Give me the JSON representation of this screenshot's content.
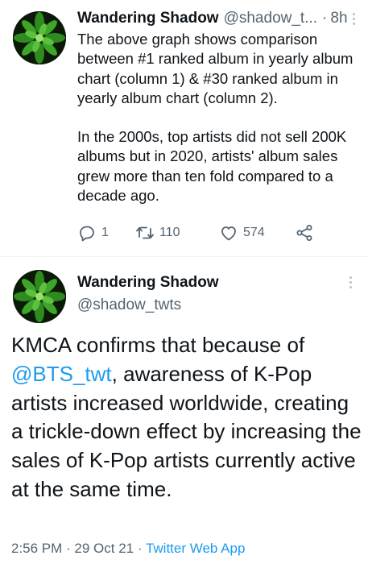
{
  "tweet1": {
    "display_name": "Wandering Shadow",
    "handle": "@shadow_t...",
    "separator": "·",
    "time": "8h",
    "paragraph1": "The above graph shows comparison between #1 ranked album in yearly album chart (column 1) & #30 ranked album in yearly album chart (column 2).",
    "paragraph2": "In the 2000s, top artists did not sell 200K albums but in 2020, artists' album sales grew more than ten fold compared to a decade ago.",
    "actions": {
      "reply_icon": "reply-icon",
      "reply_count": "1",
      "retweet_icon": "retweet-icon",
      "retweet_count": "110",
      "like_icon": "heart-icon",
      "like_count": "574",
      "share_icon": "share-icon"
    }
  },
  "tweet2": {
    "display_name": "Wandering Shadow",
    "handle": "@shadow_twts",
    "text_before": "KMCA confirms that because of ",
    "mention": "@BTS_twt",
    "text_after": ", awareness of K-Pop artists increased worldwide, creating a trickle-down effect by increasing the sales of K-Pop artists currently active at the same time.",
    "meta_time": "2:56 PM",
    "meta_sep1": " · ",
    "meta_date": "29 Oct 21",
    "meta_sep2": " · ",
    "meta_source": "Twitter Web App"
  },
  "colors": {
    "text": "#0f1419",
    "secondary": "#536471",
    "accent": "#1d9bf0",
    "divider": "#eff3f4"
  }
}
